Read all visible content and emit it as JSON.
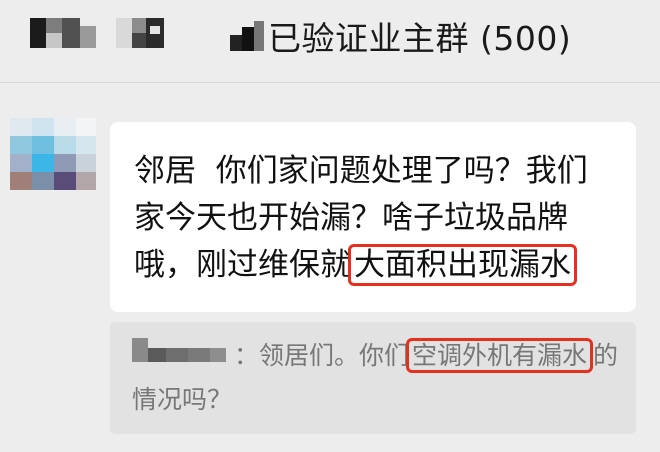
{
  "header": {
    "title": "已验证业主群 (500)"
  },
  "message": {
    "parts": [
      {
        "text": "邻居  你们家问题处理了吗？我们家今天也开始漏？啥子垃圾品牌哦，刚过维保就"
      },
      {
        "text": "大面积出现漏水",
        "highlight": true
      }
    ]
  },
  "quoted": {
    "prefix": "：领居们。你们",
    "highlight": "空调外机有漏水",
    "suffix": "的情况吗？"
  },
  "colors": {
    "background": "#ededed",
    "bubble": "#ffffff",
    "quote_bg": "#e2e2e2",
    "highlight_border": "#e5301d"
  }
}
